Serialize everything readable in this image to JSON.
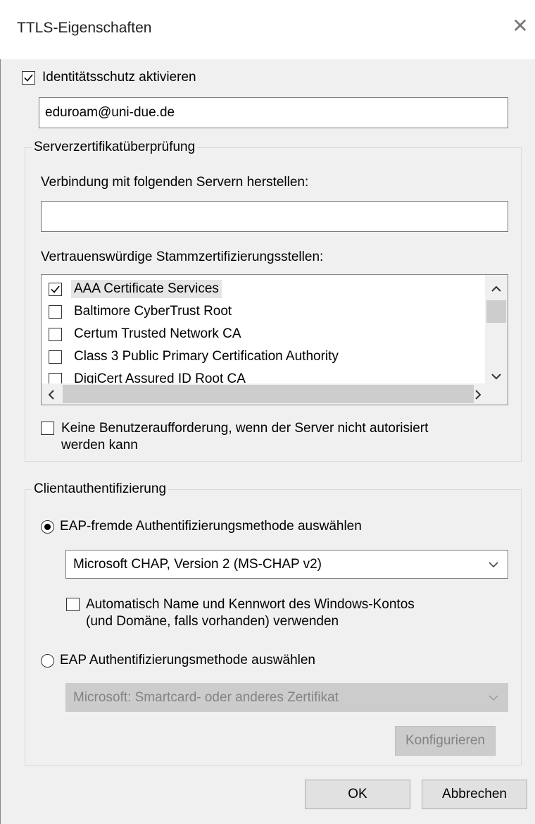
{
  "window": {
    "title": "TTLS-Eigenschaften",
    "close_glyph": "✕"
  },
  "identity": {
    "checkbox_label": "Identitätsschutz aktivieren",
    "checked": true,
    "value": "eduroam@uni-due.de"
  },
  "server_cert": {
    "legend": "Serverzertifikatüberprüfung",
    "servers_label": "Verbindung mit folgenden Servern herstellen:",
    "servers_value": "",
    "root_ca_label": "Vertrauenswürdige Stammzertifizierungsstellen:",
    "root_cas": [
      {
        "label": "AAA Certificate Services",
        "checked": true
      },
      {
        "label": "Baltimore CyberTrust Root",
        "checked": false
      },
      {
        "label": "Certum Trusted Network CA",
        "checked": false
      },
      {
        "label": "Class 3 Public Primary Certification Authority",
        "checked": false
      },
      {
        "label": "DigiCert Assured ID Root CA",
        "checked": false
      }
    ],
    "no_prompt_line1": "Keine Benutzeraufforderung, wenn der Server nicht autorisiert",
    "no_prompt_line2": "werden kann"
  },
  "client_auth": {
    "legend": "Clientauthentifizierung",
    "non_eap_label": "EAP-fremde Authentifizierungsmethode auswählen",
    "non_eap_selected": true,
    "non_eap_method": "Microsoft CHAP, Version 2 (MS-CHAP v2)",
    "auto_cred_line1": "Automatisch Name und Kennwort des Windows-Kontos",
    "auto_cred_line2": "(und Domäne, falls vorhanden) verwenden",
    "eap_label": "EAP Authentifizierungsmethode auswählen",
    "eap_method": "Microsoft: Smartcard- oder anderes Zertifikat",
    "configure_label": "Konfigurieren"
  },
  "buttons": {
    "ok": "OK",
    "cancel": "Abbrechen"
  }
}
